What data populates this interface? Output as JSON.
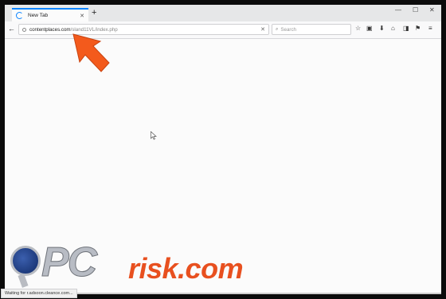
{
  "tab": {
    "title": "New Tab",
    "close_glyph": "✕"
  },
  "newtab_glyph": "+",
  "window_controls": {
    "minimize": "—",
    "maximize": "☐",
    "close": "✕"
  },
  "nav": {
    "back_glyph": "←"
  },
  "url": {
    "host": "contentplaces.com",
    "path": "/sland11VL/index.php",
    "clear_glyph": "✕"
  },
  "search": {
    "placeholder": "Search",
    "icon_glyph": "⌕"
  },
  "toolbar_icons": [
    "star-icon",
    "clipboard-icon",
    "download-icon",
    "home-icon",
    "pocket-icon",
    "extension-icon",
    "menu-icon"
  ],
  "toolbar_glyphs": {
    "star": "☆",
    "clipboard": "▣",
    "download": "⬇",
    "home": "⌂",
    "pocket": "◨",
    "extension": "⚑",
    "menu": "≡"
  },
  "status": {
    "text": "Waiting for r.adsoon.cleance.com..."
  },
  "watermark": {
    "pc": "PC",
    "risk": "risk.com"
  },
  "colors": {
    "accent": "#0a84ff",
    "arrow": "#f35a1c",
    "risk": "#e8501f"
  }
}
